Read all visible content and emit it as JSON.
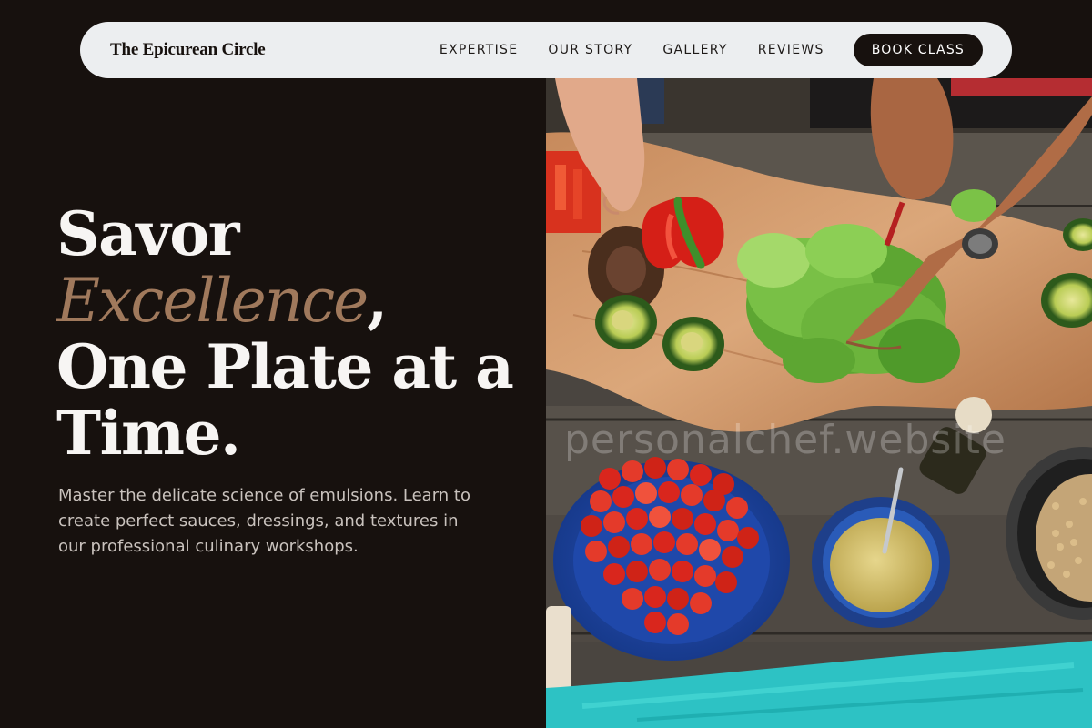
{
  "brand": "The Epicurean Circle",
  "nav": {
    "links": [
      "EXPERTISE",
      "OUR STORY",
      "GALLERY",
      "REVIEWS"
    ],
    "cta": "BOOK CLASS"
  },
  "hero": {
    "headline_1": "Savor",
    "headline_accent": "Excellence",
    "headline_comma": ",",
    "headline_2": "One Plate at a",
    "headline_3": "Time.",
    "subtext": "Master the delicate science of emulsions. Learn to create perfect sauces, dressings, and textures in our professional culinary workshops."
  },
  "watermark": "personalchef.website",
  "colors": {
    "background": "#17110e",
    "nav_bg": "#eceef0",
    "accent": "#a0795c",
    "text_light": "#f7f5f3"
  }
}
